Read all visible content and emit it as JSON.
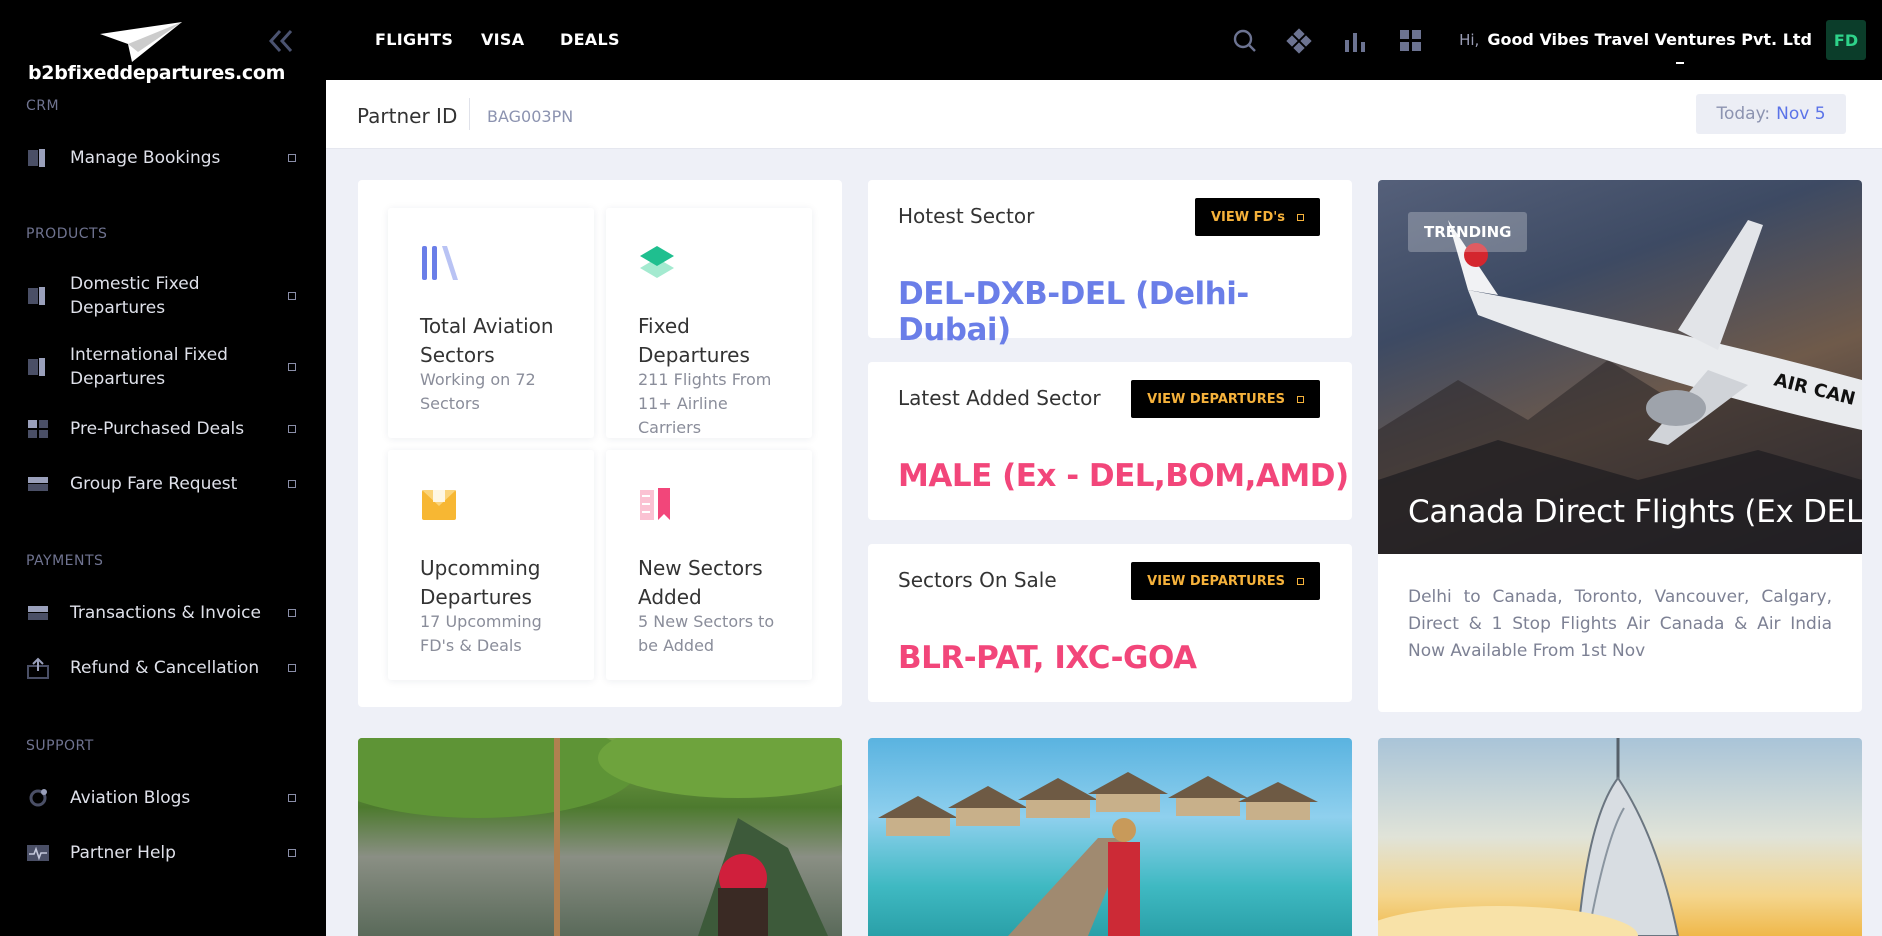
{
  "brand": {
    "logo_text": "b2bfixeddepartures.com"
  },
  "sidebar": {
    "sections": [
      {
        "label": "CRM"
      },
      {
        "label": "PRODUCTS"
      },
      {
        "label": "PAYMENTS"
      },
      {
        "label": "SUPPORT"
      }
    ],
    "items": [
      {
        "label": "Manage Bookings",
        "icon": "bookings-icon"
      },
      {
        "label": "Domestic Fixed Departures",
        "icon": "domestic-icon"
      },
      {
        "label": "International Fixed Departures",
        "icon": "international-icon"
      },
      {
        "label": "Pre-Purchased Deals",
        "icon": "deals-icon"
      },
      {
        "label": "Group Fare Request",
        "icon": "group-fare-icon"
      },
      {
        "label": "Transactions & Invoice",
        "icon": "card-icon"
      },
      {
        "label": "Refund & Cancellation",
        "icon": "refund-icon"
      },
      {
        "label": "Aviation Blogs",
        "icon": "blog-icon"
      },
      {
        "label": "Partner Help",
        "icon": "pulse-icon"
      }
    ]
  },
  "topbar": {
    "menu": [
      "FLIGHTS",
      "VISA",
      "DEALS"
    ],
    "greeting_prefix": "Hi,",
    "user_name": "Good Vibes Travel Ventures Pvt. Ltd",
    "avatar_initials": "FD"
  },
  "partner": {
    "label": "Partner ID",
    "value": "BAG003PN",
    "today_label": "Today:",
    "today_value": "Nov 5"
  },
  "stats": [
    {
      "title": "Total Aviation Sectors",
      "subtitle": "Working on 72 Sectors",
      "icon": "sectors-icon"
    },
    {
      "title": "Fixed Departures",
      "subtitle": "211 Flights From 11+ Airline Carriers",
      "icon": "layers-icon"
    },
    {
      "title": "Upcomming Departures",
      "subtitle": "17 Upcomming FD's & Deals",
      "icon": "envelope-icon"
    },
    {
      "title": "New Sectors Added",
      "subtitle": "5 New Sectors to be Added",
      "icon": "bookmark-icon"
    }
  ],
  "sectors": [
    {
      "heading": "Hotest Sector",
      "button": "VIEW FD's",
      "value": "DEL-DXB-DEL (Delhi-Dubai)",
      "color": "#6a7ee8"
    },
    {
      "heading": "Latest Added Sector",
      "button": "VIEW DEPARTURES",
      "value": "MALE (Ex - DEL,BOM,AMD)",
      "color": "#f2467a"
    },
    {
      "heading": "Sectors On Sale",
      "button": "VIEW DEPARTURES",
      "value": "BLR-PAT, IXC-GOA",
      "color": "#f2467a"
    }
  ],
  "featured": {
    "badge": "TRENDING",
    "title": "Canada Direct Flights (Ex DEL)",
    "description": "Delhi to Canada, Toronto, Vancouver, Calgary, Direct & 1 Stop Flights Air Canada & Air India Now Available From 1st Nov",
    "plane_text": "AIR CAN"
  }
}
